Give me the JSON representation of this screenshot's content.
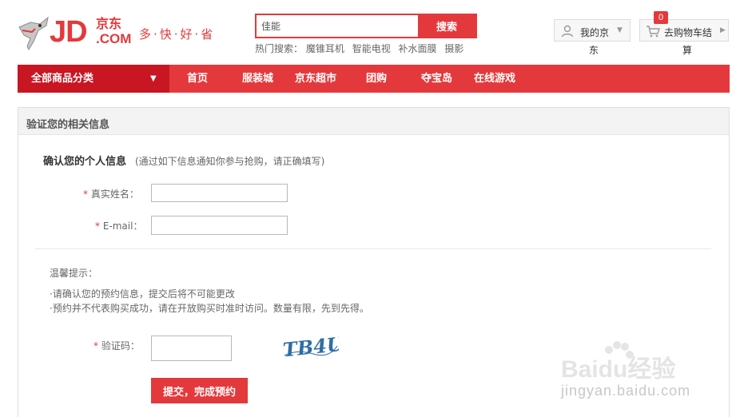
{
  "header": {
    "logo_text": "JD",
    "logo_cn": "京东",
    "logo_com": ".COM",
    "slogan": "多·快·好·省",
    "search": {
      "value": "佳能",
      "button": "搜索"
    },
    "hot_label": "热门搜索：",
    "hot_links": [
      "魔锥耳机",
      "智能电视",
      "补水面膜",
      "摄影"
    ],
    "myjd": {
      "label": "我的京",
      "label_wrap": "东"
    },
    "cart": {
      "count": "0",
      "label": "去购物车结",
      "label_wrap": "算"
    }
  },
  "nav": {
    "all": "全部商品分类",
    "items": [
      "首页",
      "服装城",
      "京东超市",
      "团购",
      "夺宝岛",
      "在线游戏"
    ]
  },
  "panel": {
    "title": "验证您的相关信息",
    "section_title": "确认您的个人信息",
    "section_note": "(通过如下信息通知你参与抢购，请正确填写)",
    "fields": {
      "name_label": "真实姓名：",
      "email_label": "E-mail：",
      "captcha_label": "验证码："
    },
    "required_mark": "*",
    "tips": {
      "title": "温馨提示：",
      "lines": [
        "·请确认您的预约信息，提交后将不可能更改",
        "·预约并不代表购买成功，请在开放购买时准时访问。数量有限，先到先得。"
      ]
    },
    "captcha_text": "TB4U",
    "submit": "提交，完成预约"
  },
  "watermark": {
    "logo": "Baidu经验",
    "url": "jingyan.baidu.com"
  },
  "colors": {
    "brand_red": "#e4393c",
    "nav_dark_red": "#c81623"
  }
}
